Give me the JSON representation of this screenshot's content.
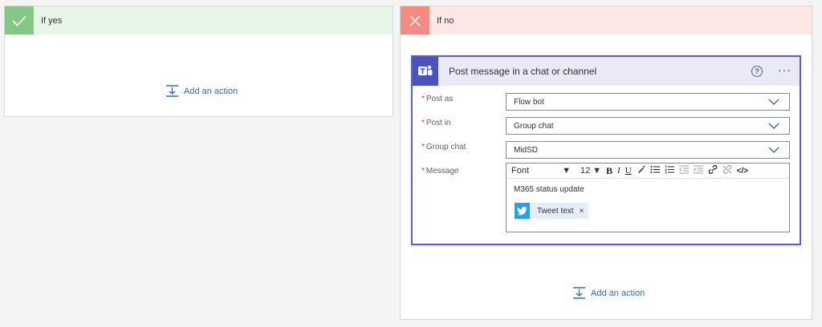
{
  "yes_branch": {
    "title": "If yes",
    "add_action_label": "Add an action"
  },
  "no_branch": {
    "title": "If no",
    "add_action_label": "Add an action"
  },
  "card": {
    "title": "Post message in a chat or channel",
    "help_glyph": "?",
    "more_glyph": "···",
    "fields": {
      "post_as": {
        "label": "Post as",
        "value": "Flow bot"
      },
      "post_in": {
        "label": "Post in",
        "value": "Group chat"
      },
      "group_chat": {
        "label": "Group chat",
        "value": "MidSD"
      },
      "message": {
        "label": "Message",
        "toolbar": {
          "font": "Font",
          "size": "12",
          "bold": "B",
          "italic": "I",
          "underline": "U",
          "code": "</>"
        },
        "text": "M365 status update",
        "token_label": "Tweet text",
        "token_remove": "×"
      }
    },
    "required_marker": "*"
  },
  "colors": {
    "yes_accent": "#86c686",
    "no_accent": "#f28b82",
    "teams_purple": "#4b53bc",
    "link_blue": "#2f6dbf",
    "twitter_blue": "#1da1f2"
  },
  "icons": {
    "yes": "check-icon",
    "no": "close-icon",
    "teams": "teams-logo-icon",
    "twitter": "twitter-icon",
    "add_action": "add-action-icon"
  }
}
